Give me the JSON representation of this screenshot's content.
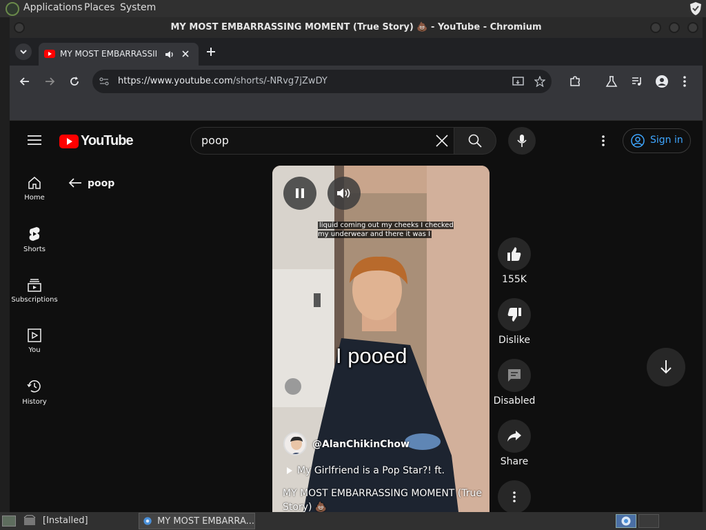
{
  "os_panel": {
    "menus": [
      "Applications",
      "Places",
      "System"
    ]
  },
  "window": {
    "title": "MY MOST EMBARRASSING MOMENT (True Story) 💩 - YouTube - Chromium"
  },
  "browser": {
    "tab_title": "MY MOST EMBARRASSIN",
    "url_host": "https://www.youtube.com",
    "url_path": "/shorts/-NRvg7jZwDY"
  },
  "youtube": {
    "logo_text": "YouTube",
    "search_value": "poop",
    "sign_in_label": "Sign in",
    "nav": [
      {
        "label": "Home",
        "icon": "home-icon"
      },
      {
        "label": "Shorts",
        "icon": "shorts-icon"
      },
      {
        "label": "Subscriptions",
        "icon": "subscriptions-icon"
      },
      {
        "label": "You",
        "icon": "you-icon"
      },
      {
        "label": "History",
        "icon": "history-icon"
      }
    ],
    "back_query": "poop",
    "short": {
      "caption_top": "liquid coming out my cheeks I checked my underwear and there it was I",
      "caption_big": "I pooed",
      "channel": "@AlanChikinChow",
      "playlist": "My Girlfriend is a Pop Star?! ft.",
      "title": "MY MOST EMBARRASSING MOMENT (True Story) 💩"
    },
    "actions": {
      "like_count": "155K",
      "dislike_label": "Dislike",
      "comments_label": "Disabled",
      "share_label": "Share"
    },
    "colors": {
      "brand_red": "#ff0000",
      "link_blue": "#3ea6ff"
    }
  },
  "taskbar": {
    "items": [
      "[Installed]",
      "MY MOST EMBARRA..."
    ]
  }
}
